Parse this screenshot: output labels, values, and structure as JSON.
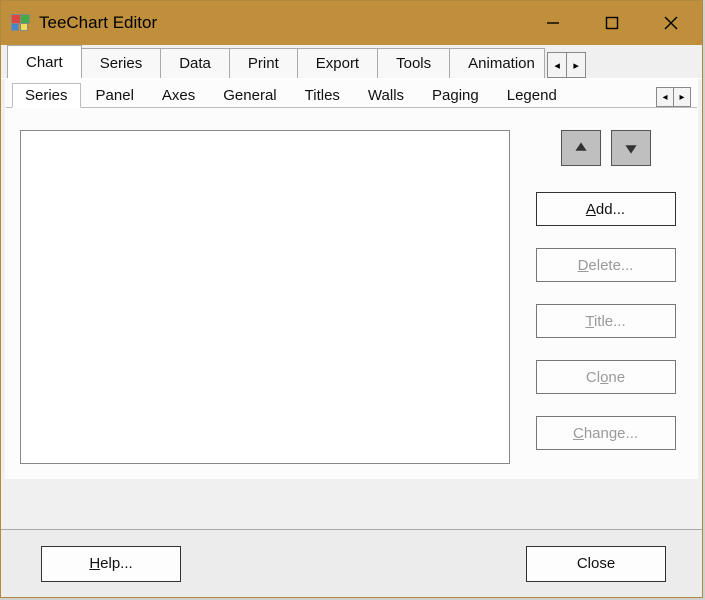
{
  "window": {
    "title": "TeeChart Editor"
  },
  "outer_tabs": {
    "items": [
      {
        "label": "Chart",
        "active": true
      },
      {
        "label": "Series"
      },
      {
        "label": "Data"
      },
      {
        "label": "Print"
      },
      {
        "label": "Export"
      },
      {
        "label": "Tools"
      },
      {
        "label": "Animation"
      }
    ]
  },
  "inner_tabs": {
    "items": [
      {
        "label": "Series",
        "active": true
      },
      {
        "label": "Panel"
      },
      {
        "label": "Axes"
      },
      {
        "label": "General"
      },
      {
        "label": "Titles"
      },
      {
        "label": "Walls"
      },
      {
        "label": "Paging"
      },
      {
        "label": "Legend"
      }
    ]
  },
  "actions": {
    "add": {
      "pre": "",
      "u": "A",
      "post": "dd...",
      "disabled": false
    },
    "delete": {
      "pre": "",
      "u": "D",
      "post": "elete...",
      "disabled": true
    },
    "title": {
      "pre": "",
      "u": "T",
      "post": "itle...",
      "disabled": true
    },
    "clone": {
      "pre": "Cl",
      "u": "o",
      "post": "ne",
      "disabled": true
    },
    "change": {
      "pre": "",
      "u": "C",
      "post": "hange...",
      "disabled": true
    }
  },
  "footer": {
    "help": {
      "pre": "",
      "u": "H",
      "post": "elp..."
    },
    "close": {
      "label": "Close"
    }
  }
}
